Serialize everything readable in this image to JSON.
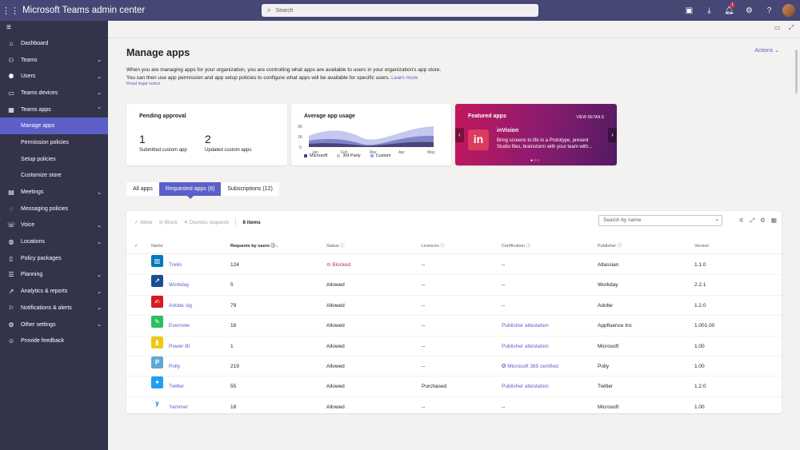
{
  "topbar": {
    "title": "Microsoft Teams admin center",
    "search_placeholder": "Search",
    "notification_count": "1"
  },
  "sidebar": {
    "items": [
      {
        "label": "Dashboard",
        "icon": "home-icon"
      },
      {
        "label": "Teams",
        "icon": "teams-icon"
      },
      {
        "label": "Users",
        "icon": "users-icon"
      },
      {
        "label": "Teams devices",
        "icon": "devices-icon"
      },
      {
        "label": "Teams apps",
        "icon": "apps-icon"
      },
      {
        "label": "Manage apps",
        "icon": ""
      },
      {
        "label": "Permission policies",
        "icon": ""
      },
      {
        "label": "Setup policies",
        "icon": ""
      },
      {
        "label": "Customize store",
        "icon": ""
      },
      {
        "label": "Meetings",
        "icon": "meetings-icon"
      },
      {
        "label": "Messaging policies",
        "icon": "messaging-icon"
      },
      {
        "label": "Voice",
        "icon": "voice-icon"
      },
      {
        "label": "Locations",
        "icon": "locations-icon"
      },
      {
        "label": "Policy packages",
        "icon": "policy-packages-icon"
      },
      {
        "label": "Planning",
        "icon": "planning-icon"
      },
      {
        "label": "Analytics & reports",
        "icon": "analytics-icon"
      },
      {
        "label": "Notifications & alerts",
        "icon": "notifications-icon"
      },
      {
        "label": "Other settings",
        "icon": "settings-icon"
      },
      {
        "label": "Provide feedback",
        "icon": "feedback-icon"
      }
    ]
  },
  "page": {
    "title": "Manage apps",
    "actions_label": "Actions",
    "description_1": "When you are managing apps for your organization, you are controlling what apps are available to users in your organization's app store.",
    "description_2": "You can then use app permission and app setup policies to configure what apps will be available for specific users.",
    "learn_more": "Learn more",
    "legal_notice": "Read legal notice"
  },
  "pending_card": {
    "title": "Pending approval",
    "submitted_count": "1",
    "submitted_label": "Submitted custom app",
    "updated_count": "2",
    "updated_label": "Updated custom apps"
  },
  "usage_card": {
    "title": "Average app usage",
    "y_ticks": [
      "2K",
      "1K",
      "0"
    ],
    "x_ticks": [
      "Jan",
      "Feb",
      "Mar",
      "Apr",
      "May"
    ],
    "legend": [
      "Microsoft",
      "3rd Party",
      "Custom"
    ]
  },
  "featured_card": {
    "title": "Featured apps",
    "view_details": "VIEW DETAILS",
    "app_name": "inVision",
    "logo_text": "in",
    "app_description": "Bring screens to life in a Prototype, present Studio files, brainstorm with your team with..."
  },
  "tabs": [
    {
      "label": "All apps"
    },
    {
      "label": "Requested apps (8)"
    },
    {
      "label": "Subscriptions (12)"
    }
  ],
  "toolbar": {
    "allow": "Allow",
    "block": "Block",
    "dismiss": "Dismiss requests",
    "count": "8 items",
    "search_placeholder": "Search by name"
  },
  "table": {
    "headers": {
      "name": "Name",
      "requests": "Requests by users",
      "status": "Status",
      "licences": "Licences",
      "certification": "Certification",
      "publisher": "Publisher",
      "version": "Version"
    },
    "rows": [
      {
        "name": "Trello",
        "requests": "124",
        "status": "Blocked",
        "licences": "--",
        "certification": "--",
        "publisher": "Atlassian",
        "version": "1.1.0",
        "color": "#0079bf",
        "glyph": "▥"
      },
      {
        "name": "Workday",
        "requests": "5",
        "status": "Allowed",
        "licences": "--",
        "certification": "--",
        "publisher": "Workday",
        "version": "2.2.1",
        "color": "#1b4d8f",
        "glyph": "↗"
      },
      {
        "name": "Adobe sig",
        "requests": "79",
        "status": "Allowed",
        "licences": "--",
        "certification": "--",
        "publisher": "Adobe",
        "version": "1.2.0",
        "color": "#d71920",
        "glyph": "✍"
      },
      {
        "name": "Evernote",
        "requests": "16",
        "status": "Allowed",
        "licences": "--",
        "certification": "Publisher attestation",
        "publisher": "Appfluence Inc",
        "version": "1.001.00",
        "color": "#2dbe60",
        "glyph": "✎"
      },
      {
        "name": "Power BI",
        "requests": "1",
        "status": "Allowed",
        "licences": "--",
        "certification": "Publisher attestation",
        "publisher": "Microsoft",
        "version": "1.00",
        "color": "#f2c811",
        "glyph": "▮"
      },
      {
        "name": "Polly",
        "requests": "219",
        "status": "Allowed",
        "licences": "--",
        "certification": "Microsoft 365 certified",
        "publisher": "Polly",
        "version": "1.00",
        "color": "#5fa8d3",
        "glyph": "P"
      },
      {
        "name": "Twitter",
        "requests": "55",
        "status": "Allowed",
        "licences": "Purchased",
        "certification": "Publisher attestation",
        "publisher": "Twitter",
        "version": "1.2.0",
        "color": "#1da1f2",
        "glyph": "✦"
      },
      {
        "name": "Yammer",
        "requests": "18",
        "status": "Allowed",
        "licences": "--",
        "certification": "--",
        "publisher": "Microsoft",
        "version": "1.00",
        "color": "#ffffff",
        "glyph": "y"
      }
    ]
  },
  "colors": {
    "topbar": "#464775",
    "sidebar": "#33344a",
    "accent": "#5b5fc7",
    "blocked": "#c4314b"
  }
}
